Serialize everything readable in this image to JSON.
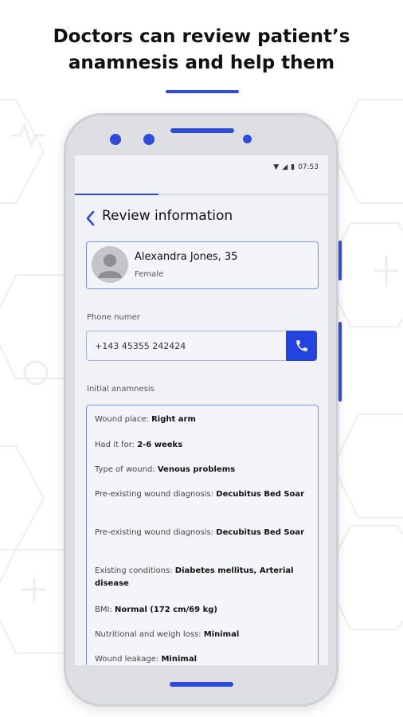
{
  "headline": {
    "line1": "Doctors can review patient’s",
    "line2": "anamnesis and help them"
  },
  "status_bar": {
    "time": "07:53",
    "icons": [
      "wifi-icon",
      "signal-icon",
      "battery-icon"
    ]
  },
  "progress": {
    "fraction": 0.33
  },
  "header": {
    "title": "Review information",
    "back_icon": "chevron-left-icon"
  },
  "patient": {
    "name": "Alexandra Jones, 35",
    "gender": "Female",
    "avatar_icon": "user-avatar-icon"
  },
  "phone": {
    "label": "Phone numer",
    "value": "+143 45355 242424",
    "call_icon": "phone-icon"
  },
  "anamnesis": {
    "label": "Initial anamnesis",
    "items": [
      {
        "key": "Wound place:",
        "value": "Right arm"
      },
      {
        "key": "Had it for:",
        "value": "2-6 weeks"
      },
      {
        "key": "Type of wound:",
        "value": "Venous problems"
      },
      {
        "key": "Pre-existing wound diagnosis:",
        "value": "Decubitus Bed Soar"
      },
      {
        "key": "Pre-existing wound diagnosis:",
        "value": "Decubitus Bed Soar"
      },
      {
        "key": "Existing conditions:",
        "value": "Diabetes mellitus, Arterial disease"
      },
      {
        "key": "BMI:",
        "value": "Normal (172 cm/69 kg)"
      },
      {
        "key": "Nutritional and weigh loss:",
        "value": "Minimal"
      },
      {
        "key": "Wound leakage:",
        "value": "Minimal"
      }
    ]
  },
  "colors": {
    "accent": "#2f4bdc",
    "button": "#2344e0",
    "border": "#7b8ff0"
  }
}
